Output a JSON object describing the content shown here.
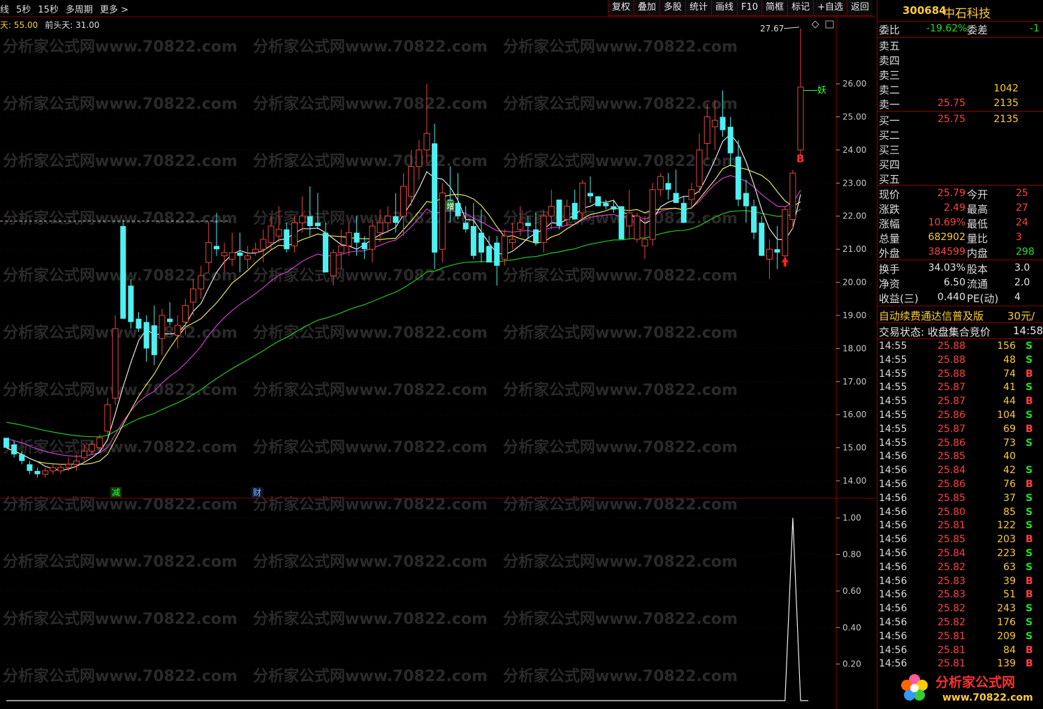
{
  "toolbar": {
    "period_items": [
      "线",
      "5秒",
      "15秒",
      "多周期",
      "更多 >"
    ],
    "buttons": [
      "复权",
      "叠加",
      "多股",
      "统计",
      "画线",
      "F10",
      "简框",
      "标记",
      "+自选",
      "返回"
    ]
  },
  "indicator_line": {
    "item1": "天: 55.00",
    "item2": "前头天: 31.00"
  },
  "watermark": "分析家公式网www.70822.com",
  "main_axis": {
    "ticks": [
      "26.00",
      "25.00",
      "24.00",
      "23.00",
      "22.00",
      "21.00",
      "20.00",
      "19.00",
      "18.00",
      "17.00",
      "16.00",
      "15.00",
      "14.00"
    ],
    "values": [
      26,
      25,
      24,
      23,
      22,
      21,
      20,
      19,
      18,
      17,
      16,
      15,
      14
    ]
  },
  "sub_axis": {
    "ticks": [
      "1.00",
      "0.80",
      "0.60",
      "0.40",
      "0.20"
    ],
    "values": [
      1.0,
      0.8,
      0.6,
      0.4,
      0.2
    ]
  },
  "markers": {
    "peak_label": "27.67",
    "signal_b": "B",
    "yao": "妖",
    "jian": "减",
    "cai": "财",
    "zeng": "增"
  },
  "colors": {
    "up": "#e8483c",
    "down": "#4ef0f0",
    "ma_white": "#e6e6e6",
    "ma_yellow": "#e8e860",
    "ma_magenta": "#d040d0",
    "ma_green": "#20c820",
    "frame": "#8a0000"
  },
  "chart_data": {
    "type": "candlestick",
    "ylim": [
      13.6,
      27.9
    ],
    "sub_ylim": [
      0,
      1.1
    ],
    "candles": [
      [
        15.3,
        15.3,
        15.0,
        15.0
      ],
      [
        15.1,
        15.2,
        14.7,
        14.8
      ],
      [
        14.8,
        14.9,
        14.5,
        14.6
      ],
      [
        14.5,
        14.6,
        14.2,
        14.3
      ],
      [
        14.3,
        14.4,
        14.1,
        14.2
      ],
      [
        14.2,
        14.4,
        14.1,
        14.3
      ],
      [
        14.3,
        14.5,
        14.2,
        14.4
      ],
      [
        14.3,
        14.5,
        14.2,
        14.4
      ],
      [
        14.4,
        14.7,
        14.3,
        14.5
      ],
      [
        14.5,
        14.8,
        14.3,
        14.6
      ],
      [
        14.7,
        15.1,
        14.6,
        14.9
      ],
      [
        14.9,
        15.2,
        14.8,
        15.1
      ],
      [
        15.0,
        15.4,
        14.9,
        15.3
      ],
      [
        15.5,
        16.5,
        15.4,
        16.3
      ],
      [
        16.5,
        19.0,
        16.3,
        18.6
      ],
      [
        21.7,
        21.9,
        18.9,
        18.9
      ],
      [
        19.9,
        20.1,
        18.6,
        18.8
      ],
      [
        18.9,
        19.1,
        18.5,
        18.6
      ],
      [
        18.8,
        19.0,
        17.6,
        18.0
      ],
      [
        18.7,
        19.3,
        17.5,
        17.8
      ],
      [
        18.3,
        19.2,
        17.8,
        19.0
      ],
      [
        18.9,
        19.4,
        18.7,
        18.8
      ],
      [
        18.4,
        19.0,
        18.0,
        18.7
      ],
      [
        18.8,
        19.5,
        18.4,
        19.3
      ],
      [
        19.4,
        20.1,
        19.0,
        19.8
      ],
      [
        19.8,
        20.5,
        19.5,
        20.2
      ],
      [
        20.6,
        21.8,
        20.3,
        21.2
      ],
      [
        21.1,
        22.1,
        20.8,
        21.0
      ],
      [
        20.8,
        21.2,
        20.3,
        20.9
      ],
      [
        20.7,
        21.5,
        20.5,
        20.9
      ],
      [
        20.9,
        21.5,
        20.3,
        20.8
      ],
      [
        20.7,
        21.1,
        20.4,
        20.8
      ],
      [
        20.9,
        21.2,
        20.8,
        21.0
      ],
      [
        21.0,
        21.6,
        20.6,
        21.3
      ],
      [
        21.2,
        22.0,
        21.0,
        21.7
      ],
      [
        21.4,
        22.3,
        21.2,
        21.6
      ],
      [
        21.6,
        21.8,
        20.9,
        21.0
      ],
      [
        21.1,
        22.0,
        20.9,
        21.8
      ],
      [
        21.8,
        22.6,
        21.5,
        22.0
      ],
      [
        22.0,
        22.9,
        21.4,
        21.7
      ],
      [
        21.8,
        22.7,
        21.6,
        21.7
      ],
      [
        21.5,
        21.8,
        20.4,
        20.3
      ],
      [
        20.2,
        21.0,
        19.9,
        20.9
      ],
      [
        20.9,
        21.6,
        20.4,
        21.1
      ],
      [
        21.1,
        21.8,
        20.8,
        21.5
      ],
      [
        21.5,
        22.0,
        20.8,
        21.2
      ],
      [
        21.2,
        21.4,
        20.7,
        21.0
      ],
      [
        21.0,
        21.9,
        20.6,
        21.7
      ],
      [
        21.5,
        22.2,
        21.2,
        21.8
      ],
      [
        21.8,
        22.3,
        21.5,
        22.0
      ],
      [
        22.0,
        22.7,
        21.5,
        21.8
      ],
      [
        22.0,
        23.3,
        21.4,
        22.9
      ],
      [
        22.6,
        24.0,
        22.3,
        23.5
      ],
      [
        23.5,
        24.3,
        23.1,
        24.0
      ],
      [
        24.0,
        26.0,
        23.6,
        24.5
      ],
      [
        24.2,
        24.8,
        20.4,
        20.9
      ],
      [
        21.0,
        23.0,
        20.6,
        22.7
      ],
      [
        22.5,
        23.5,
        21.8,
        22.3
      ],
      [
        22.4,
        23.3,
        21.9,
        22.0
      ],
      [
        21.8,
        22.3,
        21.5,
        21.6
      ],
      [
        21.7,
        22.4,
        20.7,
        20.8
      ],
      [
        21.5,
        22.2,
        20.6,
        20.9
      ],
      [
        21.1,
        21.4,
        20.6,
        20.6
      ],
      [
        21.2,
        21.4,
        19.9,
        20.5
      ],
      [
        20.7,
        21.6,
        20.5,
        21.4
      ],
      [
        21.2,
        21.8,
        21.0,
        21.3
      ],
      [
        21.6,
        22.3,
        21.4,
        21.8
      ],
      [
        21.8,
        22.0,
        21.3,
        21.7
      ],
      [
        21.6,
        22.1,
        21.1,
        21.2
      ],
      [
        21.2,
        22.2,
        20.9,
        22.0
      ],
      [
        22.0,
        22.8,
        21.6,
        22.3
      ],
      [
        22.5,
        22.5,
        21.6,
        21.7
      ],
      [
        21.9,
        22.5,
        21.7,
        22.3
      ],
      [
        22.4,
        22.8,
        21.9,
        21.9
      ],
      [
        22.1,
        23.1,
        21.9,
        23.0
      ],
      [
        22.7,
        23.2,
        22.4,
        22.6
      ],
      [
        22.6,
        22.6,
        22.3,
        22.3
      ],
      [
        22.4,
        22.5,
        22.2,
        22.3
      ],
      [
        22.3,
        22.5,
        22.1,
        22.2
      ],
      [
        22.3,
        22.3,
        21.5,
        21.3
      ],
      [
        21.7,
        22.8,
        21.3,
        22.1
      ],
      [
        21.3,
        22.1,
        21.2,
        22.0
      ],
      [
        21.1,
        22.0,
        20.7,
        21.3
      ],
      [
        21.3,
        23.0,
        21.1,
        22.8
      ],
      [
        22.8,
        23.3,
        22.6,
        23.2
      ],
      [
        23.0,
        23.3,
        22.5,
        22.8
      ],
      [
        22.7,
        23.4,
        22.4,
        22.4
      ],
      [
        22.4,
        22.6,
        21.8,
        21.8
      ],
      [
        22.5,
        23.0,
        22.2,
        22.8
      ],
      [
        22.9,
        24.5,
        22.7,
        24.0
      ],
      [
        24.2,
        25.4,
        23.7,
        25.0
      ],
      [
        24.7,
        25.5,
        24.0,
        24.9
      ],
      [
        25.0,
        25.8,
        24.4,
        24.6
      ],
      [
        24.7,
        25.0,
        23.5,
        23.9
      ],
      [
        23.8,
        24.3,
        22.3,
        22.5
      ],
      [
        22.7,
        23.1,
        21.8,
        22.3
      ],
      [
        22.3,
        22.5,
        21.3,
        21.5
      ],
      [
        21.8,
        22.0,
        20.8,
        20.8
      ],
      [
        20.7,
        21.3,
        20.1,
        21.0
      ],
      [
        21.0,
        21.7,
        20.4,
        20.9
      ],
      [
        20.8,
        22.3,
        20.6,
        22.2
      ],
      [
        21.9,
        23.4,
        21.6,
        23.3
      ],
      [
        24.0,
        25.9,
        23.8,
        25.9
      ]
    ],
    "sub_series": [
      0,
      0,
      0,
      0,
      0,
      0,
      0,
      0,
      0,
      0,
      0,
      0,
      0,
      0,
      0,
      0,
      0,
      0,
      0,
      0,
      0,
      0,
      0,
      0,
      0,
      0,
      0,
      0,
      0,
      0,
      0,
      0,
      0,
      0,
      0,
      0,
      0,
      0,
      0,
      0,
      0,
      0,
      0,
      0,
      0,
      0,
      0,
      0,
      0,
      0,
      0,
      0,
      0,
      0,
      0,
      0,
      0,
      0,
      0,
      0,
      0,
      0,
      0,
      0,
      0,
      0,
      0,
      0,
      0,
      0,
      0,
      0,
      0,
      0,
      0,
      0,
      0,
      0,
      0,
      0,
      0,
      0,
      0,
      0,
      0,
      0,
      0,
      0,
      0,
      0,
      0,
      0,
      0,
      0,
      0,
      0,
      0,
      0,
      0,
      0,
      0,
      1.0,
      0,
      0
    ]
  },
  "panel": {
    "code": "300684",
    "name": "中石科技",
    "weibi_label": "委比",
    "weibi_value": "-19.62%",
    "weicha_label": "委差",
    "weicha_value": "-1",
    "sell": [
      {
        "label": "卖五",
        "price": "",
        "vol": ""
      },
      {
        "label": "卖四",
        "price": "",
        "vol": ""
      },
      {
        "label": "卖三",
        "price": "",
        "vol": ""
      },
      {
        "label": "卖二",
        "price": "",
        "vol": "1042"
      },
      {
        "label": "卖一",
        "price": "25.75",
        "vol": "2135"
      }
    ],
    "buy": [
      {
        "label": "买一",
        "price": "25.75",
        "vol": "2135"
      },
      {
        "label": "买二",
        "price": "",
        "vol": ""
      },
      {
        "label": "买三",
        "price": "",
        "vol": ""
      },
      {
        "label": "买四",
        "price": "",
        "vol": ""
      },
      {
        "label": "买五",
        "price": "",
        "vol": ""
      }
    ],
    "stats": [
      {
        "l1": "现价",
        "v1": "25.79",
        "l2": "今开",
        "v2": "25",
        "c1": "#ff4040",
        "c2": "#ff4040"
      },
      {
        "l1": "涨跌",
        "v1": "2.49",
        "l2": "最高",
        "v2": "27",
        "c1": "#ff4040",
        "c2": "#ff4040"
      },
      {
        "l1": "涨幅",
        "v1": "10.69%",
        "l2": "最低",
        "v2": "24",
        "c1": "#ff4040",
        "c2": "#ff4040"
      },
      {
        "l1": "总量",
        "v1": "682902",
        "l2": "量比",
        "v2": "3",
        "c1": "#ffcc33",
        "c2": "#ff4040"
      },
      {
        "l1": "外盘",
        "v1": "384599",
        "l2": "内盘",
        "v2": "298",
        "c1": "#ff4040",
        "c2": "#20e020"
      }
    ],
    "stats2": [
      {
        "l1": "换手",
        "v1": "34.03%",
        "l2": "股本",
        "v2": "3.0"
      },
      {
        "l1": "净资",
        "v1": "6.50",
        "l2": "流通",
        "v2": "2.0"
      },
      {
        "l1": "收益(三)",
        "v1": "0.440",
        "l2": "PE(动)",
        "v2": "4"
      }
    ],
    "promo_left": "自动续费通达信普及版",
    "promo_right": "30元/",
    "trade_status": "交易状态: 收盘集合竞价",
    "trade_time": "14:58",
    "ticks": [
      {
        "t": "14:55",
        "p": "25.88",
        "q": "156",
        "d": "S"
      },
      {
        "t": "14:55",
        "p": "25.88",
        "q": "48",
        "d": "S"
      },
      {
        "t": "14:55",
        "p": "25.88",
        "q": "74",
        "d": "B"
      },
      {
        "t": "14:55",
        "p": "25.87",
        "q": "41",
        "d": "S"
      },
      {
        "t": "14:55",
        "p": "25.87",
        "q": "44",
        "d": "B"
      },
      {
        "t": "14:55",
        "p": "25.86",
        "q": "104",
        "d": "S"
      },
      {
        "t": "14:55",
        "p": "25.87",
        "q": "69",
        "d": "B"
      },
      {
        "t": "14:55",
        "p": "25.86",
        "q": "73",
        "d": "S"
      },
      {
        "t": "14:56",
        "p": "25.85",
        "q": "40",
        "d": ""
      },
      {
        "t": "14:56",
        "p": "25.84",
        "q": "42",
        "d": "S"
      },
      {
        "t": "14:56",
        "p": "25.86",
        "q": "76",
        "d": "B"
      },
      {
        "t": "14:56",
        "p": "25.85",
        "q": "37",
        "d": "S"
      },
      {
        "t": "14:56",
        "p": "25.80",
        "q": "85",
        "d": "S"
      },
      {
        "t": "14:56",
        "p": "25.81",
        "q": "122",
        "d": "S"
      },
      {
        "t": "14:56",
        "p": "25.85",
        "q": "203",
        "d": "B"
      },
      {
        "t": "14:56",
        "p": "25.84",
        "q": "223",
        "d": "S"
      },
      {
        "t": "14:56",
        "p": "25.82",
        "q": "63",
        "d": "S"
      },
      {
        "t": "14:56",
        "p": "25.83",
        "q": "39",
        "d": "B"
      },
      {
        "t": "14:56",
        "p": "25.83",
        "q": "51",
        "d": "B"
      },
      {
        "t": "14:56",
        "p": "25.82",
        "q": "243",
        "d": "S"
      },
      {
        "t": "14:56",
        "p": "25.82",
        "q": "176",
        "d": "S"
      },
      {
        "t": "14:56",
        "p": "25.81",
        "q": "209",
        "d": "S"
      },
      {
        "t": "14:56",
        "p": "25.81",
        "q": "84",
        "d": "B"
      },
      {
        "t": "14:56",
        "p": "25.81",
        "q": "139",
        "d": "B"
      }
    ],
    "logo_text": "分析家公式网",
    "logo_url": "www.70822.com"
  }
}
